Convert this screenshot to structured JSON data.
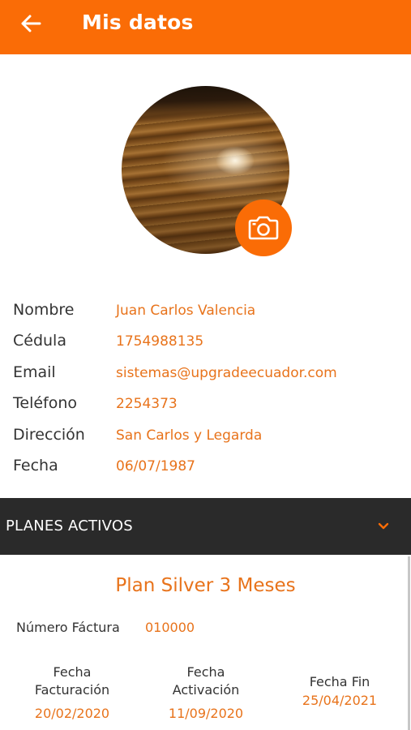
{
  "header": {
    "title": "Mis datos",
    "back_icon": "arrow-left-icon",
    "color": "#fa6c06"
  },
  "profile": {
    "camera_icon": "camera-icon"
  },
  "info": [
    {
      "label": "Nombre",
      "value": "Juan Carlos Valencia"
    },
    {
      "label": "Cédula",
      "value": "1754988135"
    },
    {
      "label": "Email",
      "value": "sistemas@upgradeecuador.com"
    },
    {
      "label": "Teléfono",
      "value": "2254373"
    },
    {
      "label": "Dirección",
      "value": "San Carlos y Legarda"
    },
    {
      "label": "Fecha",
      "value": "06/07/1987"
    }
  ],
  "plans": {
    "section_title": "PLANES ACTIVOS",
    "chevron_icon": "chevron-down-icon",
    "plan_name": "Plan Silver 3 Meses",
    "invoice_label": "Número Fáctura",
    "invoice_value": "010000",
    "dates": [
      {
        "label_line1": "Fecha",
        "label_line2": "Facturación",
        "value": "20/02/2020"
      },
      {
        "label_line1": "Fecha",
        "label_line2": "Activación",
        "value": "11/09/2020"
      },
      {
        "label_line1": "Fecha Fin",
        "label_line2": "",
        "value": "25/04/2021"
      }
    ]
  },
  "colors": {
    "accent": "#fa6c06",
    "value_text": "#e8731b",
    "dark_bar": "#2a2a2a"
  }
}
